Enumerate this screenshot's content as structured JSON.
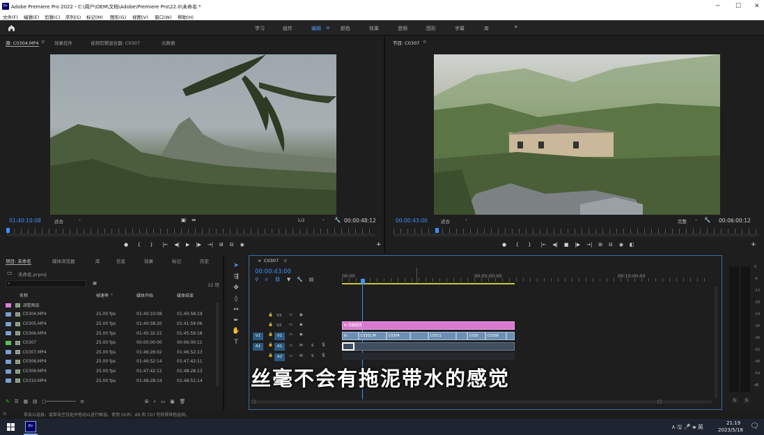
{
  "window": {
    "title": "Adobe Premiere Pro 2022 - C:\\用户\\OEM\\文档\\Adobe\\Premiere Pro\\22.0\\未命名 *",
    "app_icon": "Pr",
    "controls": {
      "minimize": "─",
      "maximize": "☐",
      "close": "✕"
    }
  },
  "menu": [
    "文件(F)",
    "编辑(E)",
    "剪辑(C)",
    "序列(S)",
    "标记(M)",
    "图形(G)",
    "视图(V)",
    "窗口(W)",
    "帮助(H)"
  ],
  "workspaces": {
    "items": [
      "学习",
      "组件",
      "编辑",
      "颜色",
      "效果",
      "音频",
      "图形",
      "字幕",
      "库"
    ],
    "active": "编辑",
    "more": "»"
  },
  "source_monitor": {
    "tabs": [
      "源: C0304.MP4",
      "效果控件",
      "音频剪辑混合器: C0307",
      "元数据"
    ],
    "timecode_in": "01:40:10:08",
    "fit": "适合",
    "resolution": "1/2",
    "timecode_out": "00:00:48:12"
  },
  "program_monitor": {
    "tab": "节目: C0307",
    "timecode_in": "00:00:43:00",
    "fit": "适合",
    "resolution": "完整",
    "timecode_out": "00:06:00:12"
  },
  "transport_glyphs": [
    "●",
    "{",
    "}",
    "|←",
    "◀|",
    "▶",
    "|▶",
    "→|",
    "⊞",
    "⊟",
    "◉"
  ],
  "project": {
    "tabs": [
      "项目: 未命名",
      "媒体浏览器",
      "库",
      "信息",
      "效果",
      "标记",
      "历史"
    ],
    "file": "未命名.prproj",
    "item_count": "12 项",
    "columns": [
      "名称",
      "帧速率",
      "媒体开始",
      "媒体结束"
    ],
    "rows": [
      {
        "name": "调整图层",
        "fps": "",
        "start": "",
        "end": "",
        "color": "#e07fd6"
      },
      {
        "name": "C0304.MP4",
        "fps": "25.00 fps",
        "start": "01:40:10:08",
        "end": "01:40:58:19",
        "color": "#7b9fd4"
      },
      {
        "name": "C0305.MP4",
        "fps": "25.00 fps",
        "start": "01:40:58:20",
        "end": "01:41:59:06",
        "color": "#7b9fd4"
      },
      {
        "name": "C0306.MP4",
        "fps": "25.00 fps",
        "start": "01:45:32:22",
        "end": "01:45:59:18",
        "color": "#7b9fd4"
      },
      {
        "name": "C0307",
        "fps": "25.00 fps",
        "start": "00:00:00:00",
        "end": "00:06:00:11",
        "color": "#55c255"
      },
      {
        "name": "C0307.MP4",
        "fps": "25.00 fps",
        "start": "01:46:28:02",
        "end": "01:46:52:13",
        "color": "#7b9fd4"
      },
      {
        "name": "C0308.MP4",
        "fps": "25.00 fps",
        "start": "01:46:52:14",
        "end": "01:47:42:11",
        "color": "#7b9fd4"
      },
      {
        "name": "C0309.MP4",
        "fps": "25.00 fps",
        "start": "01:47:42:12",
        "end": "01:48:28:13",
        "color": "#7b9fd4"
      },
      {
        "name": "C0310.MP4",
        "fps": "25.00 fps",
        "start": "01:48:28:14",
        "end": "01:48:51:14",
        "color": "#7b9fd4"
      }
    ]
  },
  "timeline": {
    "tab": "C0307",
    "timecode": "00:00:43:00",
    "ruler": [
      "00:00",
      "00:05:00:00",
      "00:10:00:00"
    ],
    "tracks": [
      {
        "patch": "",
        "label": "V3"
      },
      {
        "patch": "",
        "label": "V2"
      },
      {
        "patch": "V1",
        "label": "V1"
      },
      {
        "patch": "A1",
        "label": "A1"
      },
      {
        "patch": "",
        "label": "A2"
      }
    ],
    "track_m": "M",
    "track_s": "S",
    "adjustment_clip": "调整图层",
    "fx_badge": "fx",
    "clips": [
      "C0301.M",
      "C0304",
      "C0311",
      "C030",
      "C0308"
    ]
  },
  "audio_meter": {
    "scale": [
      "0",
      "-6",
      "-12",
      "-18",
      "-24",
      "-30",
      "-36",
      "-42",
      "-48",
      "-54",
      "dB"
    ],
    "solo": [
      "S",
      "S"
    ]
  },
  "subtitle": "丝毫不会有拖泥带水的感觉",
  "status_bar": "单击以选择，或单击空白处并拖动以进行框选。使用 Shift、Alt 和 Ctrl 可获得其他选项。",
  "taskbar": {
    "time": "21:19",
    "date": "2023/5/18",
    "tray": "∧ 🖫 🎤 🕪 英"
  },
  "colors": {
    "accent": "#3f8fff",
    "adjustment_clip": "#e07fd6",
    "video_clip": "#6e8fb3",
    "work_area": "#c8c838"
  }
}
